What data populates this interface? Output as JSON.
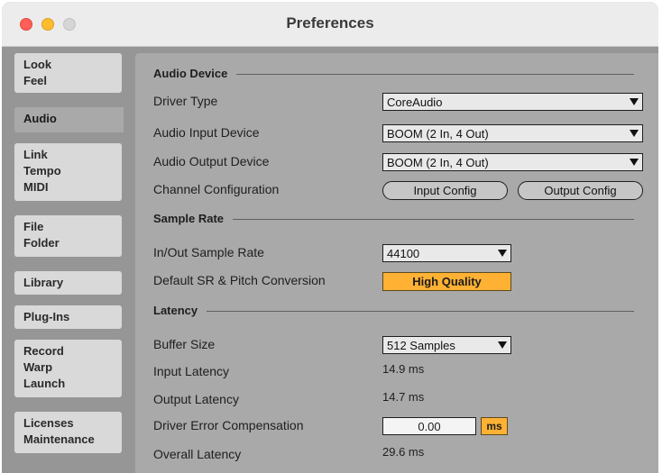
{
  "window": {
    "title": "Preferences"
  },
  "sidebar": {
    "tabs": [
      {
        "lines": [
          "Look",
          "Feel"
        ]
      },
      {
        "lines": [
          "Audio"
        ]
      },
      {
        "lines": [
          "Link",
          "Tempo",
          "MIDI"
        ]
      },
      {
        "lines": [
          "File",
          "Folder"
        ]
      },
      {
        "lines": [
          "Library"
        ]
      },
      {
        "lines": [
          "Plug-Ins"
        ]
      },
      {
        "lines": [
          "Record",
          "Warp",
          "Launch"
        ]
      },
      {
        "lines": [
          "Licenses",
          "Maintenance"
        ]
      }
    ],
    "active": "Audio"
  },
  "audio_device": {
    "heading": "Audio Device",
    "driver_type_label": "Driver Type",
    "driver_type_value": "CoreAudio",
    "input_device_label": "Audio Input Device",
    "input_device_value": "BOOM (2 In, 4 Out)",
    "output_device_label": "Audio Output Device",
    "output_device_value": "BOOM (2 In, 4 Out)",
    "channel_config_label": "Channel Configuration",
    "input_config_button": "Input Config",
    "output_config_button": "Output Config"
  },
  "sample_rate": {
    "heading": "Sample Rate",
    "inout_label": "In/Out Sample Rate",
    "inout_value": "44100",
    "default_sr_label": "Default SR & Pitch Conversion",
    "default_sr_value": "High Quality"
  },
  "latency": {
    "heading": "Latency",
    "buffer_size_label": "Buffer Size",
    "buffer_size_value": "512 Samples",
    "input_latency_label": "Input Latency",
    "input_latency_value": "14.9 ms",
    "output_latency_label": "Output Latency",
    "output_latency_value": "14.7 ms",
    "driver_error_label": "Driver Error Compensation",
    "driver_error_value": "0.00",
    "driver_error_unit": "ms",
    "overall_latency_label": "Overall Latency",
    "overall_latency_value": "29.6 ms"
  },
  "colors": {
    "accent": "#ffb133",
    "panel": "#a9a9a9",
    "background": "#969696"
  }
}
